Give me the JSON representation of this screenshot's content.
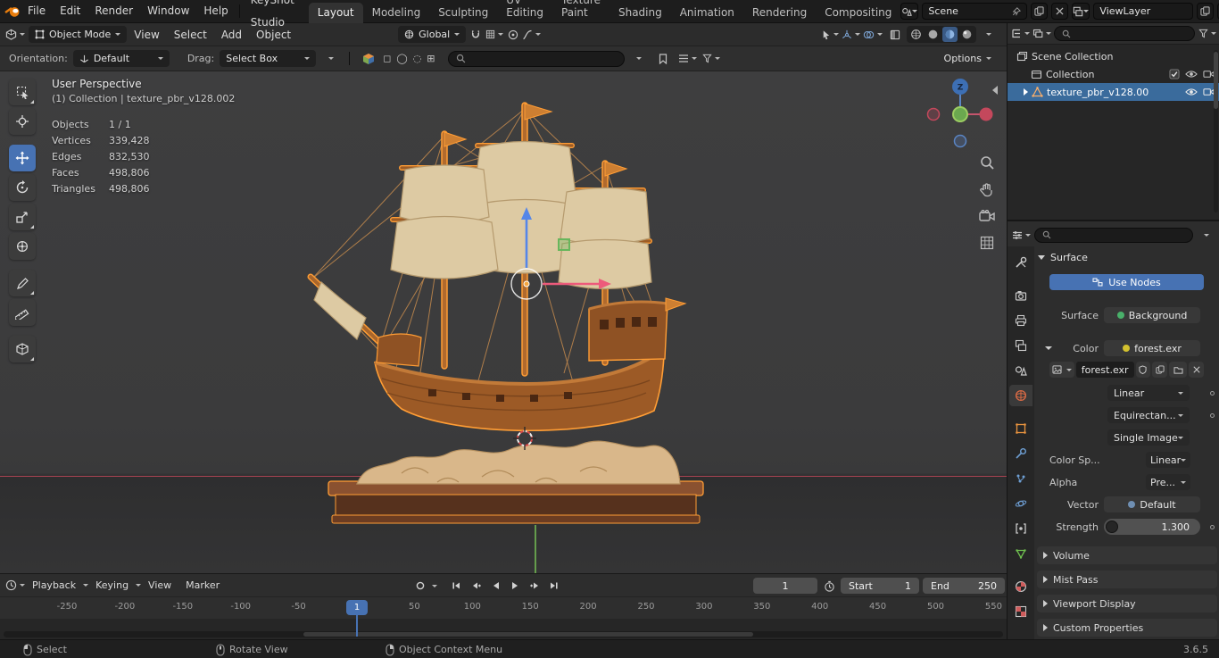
{
  "topbar": {
    "menus": [
      "File",
      "Edit",
      "Render",
      "Window",
      "Help",
      "KeyShot Studio"
    ],
    "workspaces": [
      "Layout",
      "Modeling",
      "Sculpting",
      "UV Editing",
      "Texture Paint",
      "Shading",
      "Animation",
      "Rendering",
      "Compositing"
    ],
    "scene_name": "Scene",
    "view_layer_name": "ViewLayer"
  },
  "header3d": {
    "mode": "Object Mode",
    "menus": [
      "View",
      "Select",
      "Add",
      "Object"
    ],
    "orientation": "Global"
  },
  "toolsettings": {
    "orientation_label": "Orientation:",
    "orientation_value": "Default",
    "drag_label": "Drag:",
    "drag_value": "Select Box",
    "options_label": "Options"
  },
  "viewport": {
    "view_name": "User Perspective",
    "context_path": "(1) Collection | texture_pbr_v128.002",
    "stats": {
      "rows": [
        {
          "label": "Objects",
          "value": "1 / 1"
        },
        {
          "label": "Vertices",
          "value": "339,428"
        },
        {
          "label": "Edges",
          "value": "832,530"
        },
        {
          "label": "Faces",
          "value": "498,806"
        },
        {
          "label": "Triangles",
          "value": "498,806"
        }
      ]
    },
    "gizmo_z_label": "Z"
  },
  "outliner": {
    "rows": [
      {
        "label": "Scene Collection"
      },
      {
        "label": "Collection"
      },
      {
        "label": "texture_pbr_v128.00"
      }
    ]
  },
  "properties": {
    "surface_panel": "Surface",
    "use_nodes": "Use Nodes",
    "rows": {
      "surface_label": "Surface",
      "surface_value": "Background",
      "color_label": "Color",
      "color_value": "forest.exr",
      "image_name": "forest.exr",
      "interpolation": "Linear",
      "projection": "Equirectan...",
      "source": "Single Image",
      "colorspace_label": "Color Sp...",
      "colorspace_value": "Linear",
      "alpha_label": "Alpha",
      "alpha_value": "Pre...",
      "vector_label": "Vector",
      "vector_value": "Default",
      "strength_label": "Strength",
      "strength_value": "1.300"
    },
    "collapsed_panels": [
      "Volume",
      "Mist Pass",
      "Viewport Display",
      "Custom Properties"
    ]
  },
  "timeline": {
    "menus": [
      "Playback",
      "Keying",
      "View",
      "Marker"
    ],
    "current_frame": "1",
    "playhead_label": "1",
    "start_label": "Start",
    "start_value": "1",
    "end_label": "End",
    "end_value": "250",
    "ticks": [
      "-250",
      "-200",
      "-150",
      "-100",
      "-50",
      "1",
      "50",
      "100",
      "150",
      "200",
      "250",
      "300",
      "350",
      "400",
      "450",
      "500",
      "550"
    ]
  },
  "statusbar": {
    "select_hint": "Select",
    "rotate_hint": "Rotate View",
    "context_hint": "Object Context Menu",
    "version": "3.6.5"
  },
  "colors": {
    "accent_blue": "#4772b3",
    "selection_orange": "#ff9d35",
    "outliner_select": "#3a6b9c"
  }
}
